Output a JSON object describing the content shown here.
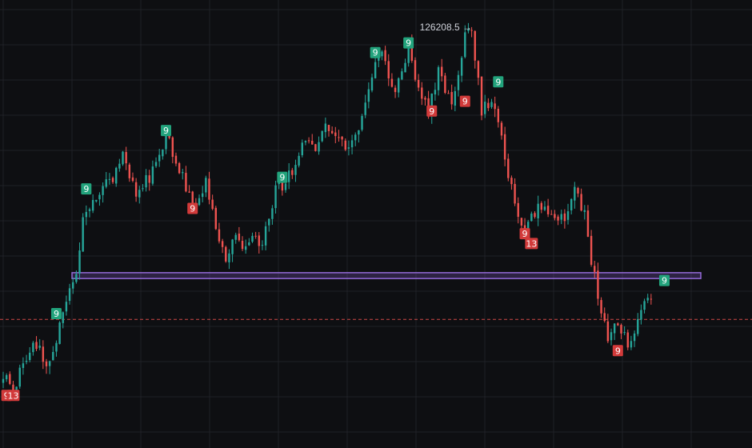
{
  "chart_data": {
    "type": "candlestick",
    "title": "",
    "xlabel": "",
    "ylabel": "",
    "grid": true,
    "ylim": [
      104600,
      127600
    ],
    "x_count": 210,
    "colors": {
      "background": "#0e0f12",
      "grid": "#1f2126",
      "up": "#26a69a",
      "down": "#ef5350",
      "band_stroke": "#9c6fe4",
      "band_fill": "#7e57c2",
      "current_price_line": "#ef5350",
      "badge_up": "#22a37c",
      "badge_down": "#d23a3a",
      "annotation_text": "#d1d4dc"
    },
    "price_path": [
      {
        "i": 0,
        "p": 108400
      },
      {
        "i": 3,
        "p": 107600
      },
      {
        "i": 8,
        "p": 109600
      },
      {
        "i": 10,
        "p": 110000
      },
      {
        "i": 13,
        "p": 108800
      },
      {
        "i": 17,
        "p": 110700
      },
      {
        "i": 20,
        "p": 113100
      },
      {
        "i": 22,
        "p": 113500
      },
      {
        "i": 24,
        "p": 116500
      },
      {
        "i": 28,
        "p": 117600
      },
      {
        "i": 33,
        "p": 118500
      },
      {
        "i": 36,
        "p": 119800
      },
      {
        "i": 40,
        "p": 117500
      },
      {
        "i": 45,
        "p": 118800
      },
      {
        "i": 49,
        "p": 120700
      },
      {
        "i": 53,
        "p": 118900
      },
      {
        "i": 57,
        "p": 117100
      },
      {
        "i": 61,
        "p": 118200
      },
      {
        "i": 64,
        "p": 116000
      },
      {
        "i": 67,
        "p": 114200
      },
      {
        "i": 70,
        "p": 115700
      },
      {
        "i": 72,
        "p": 114500
      },
      {
        "i": 76,
        "p": 115500
      },
      {
        "i": 78,
        "p": 115000
      },
      {
        "i": 82,
        "p": 117800
      },
      {
        "i": 86,
        "p": 118500
      },
      {
        "i": 90,
        "p": 120300
      },
      {
        "i": 94,
        "p": 120100
      },
      {
        "i": 98,
        "p": 121200
      },
      {
        "i": 104,
        "p": 119800
      },
      {
        "i": 108,
        "p": 121400
      },
      {
        "i": 112,
        "p": 124500
      },
      {
        "i": 114,
        "p": 124700
      },
      {
        "i": 118,
        "p": 123000
      },
      {
        "i": 122,
        "p": 125200
      },
      {
        "i": 126,
        "p": 122500
      },
      {
        "i": 128,
        "p": 121800
      },
      {
        "i": 131,
        "p": 123800
      },
      {
        "i": 135,
        "p": 122400
      },
      {
        "i": 139,
        "p": 125600
      },
      {
        "i": 141,
        "p": 126208.5
      },
      {
        "i": 144,
        "p": 122000
      },
      {
        "i": 147,
        "p": 122400
      },
      {
        "i": 150,
        "p": 120600
      },
      {
        "i": 154,
        "p": 117000
      },
      {
        "i": 157,
        "p": 115500
      },
      {
        "i": 161,
        "p": 117200
      },
      {
        "i": 165,
        "p": 116600
      },
      {
        "i": 169,
        "p": 116600
      },
      {
        "i": 172,
        "p": 117800
      },
      {
        "i": 175,
        "p": 116500
      },
      {
        "i": 177,
        "p": 114100
      },
      {
        "i": 180,
        "p": 111800
      },
      {
        "i": 182,
        "p": 109800
      },
      {
        "i": 184,
        "p": 111300
      },
      {
        "i": 188,
        "p": 110000
      },
      {
        "i": 192,
        "p": 111600
      },
      {
        "i": 194,
        "p": 112400
      },
      {
        "i": 195,
        "p": 112200
      }
    ],
    "horizontal_band": {
      "from": 113300,
      "to": 113600
    },
    "current_price_line": 111200,
    "max_annotation": {
      "i": 141,
      "price": 126208.5,
      "text": "126208.5 →"
    },
    "markers": [
      {
        "i": 1,
        "price": 107300,
        "label": "9",
        "kind": "down"
      },
      {
        "i": 3,
        "price": 107300,
        "label": "13",
        "kind": "down"
      },
      {
        "i": 16,
        "price": 111500,
        "label": "9",
        "kind": "up"
      },
      {
        "i": 25,
        "price": 117900,
        "label": "9",
        "kind": "up"
      },
      {
        "i": 49,
        "price": 120900,
        "label": "9",
        "kind": "up"
      },
      {
        "i": 57,
        "price": 116900,
        "label": "9",
        "kind": "down"
      },
      {
        "i": 84,
        "price": 118500,
        "label": "9",
        "kind": "up"
      },
      {
        "i": 112,
        "price": 124900,
        "label": "9",
        "kind": "up"
      },
      {
        "i": 122,
        "price": 125400,
        "label": "9",
        "kind": "up"
      },
      {
        "i": 129,
        "price": 121900,
        "label": "9",
        "kind": "down"
      },
      {
        "i": 139,
        "price": 122400,
        "label": "9",
        "kind": "down"
      },
      {
        "i": 149,
        "price": 123400,
        "label": "9",
        "kind": "up"
      },
      {
        "i": 157,
        "price": 115600,
        "label": "9",
        "kind": "down"
      },
      {
        "i": 159,
        "price": 115100,
        "label": "13",
        "kind": "down"
      },
      {
        "i": 185,
        "price": 109600,
        "label": "9",
        "kind": "down"
      },
      {
        "i": 199,
        "price": 113200,
        "label": "9",
        "kind": "up"
      }
    ]
  }
}
